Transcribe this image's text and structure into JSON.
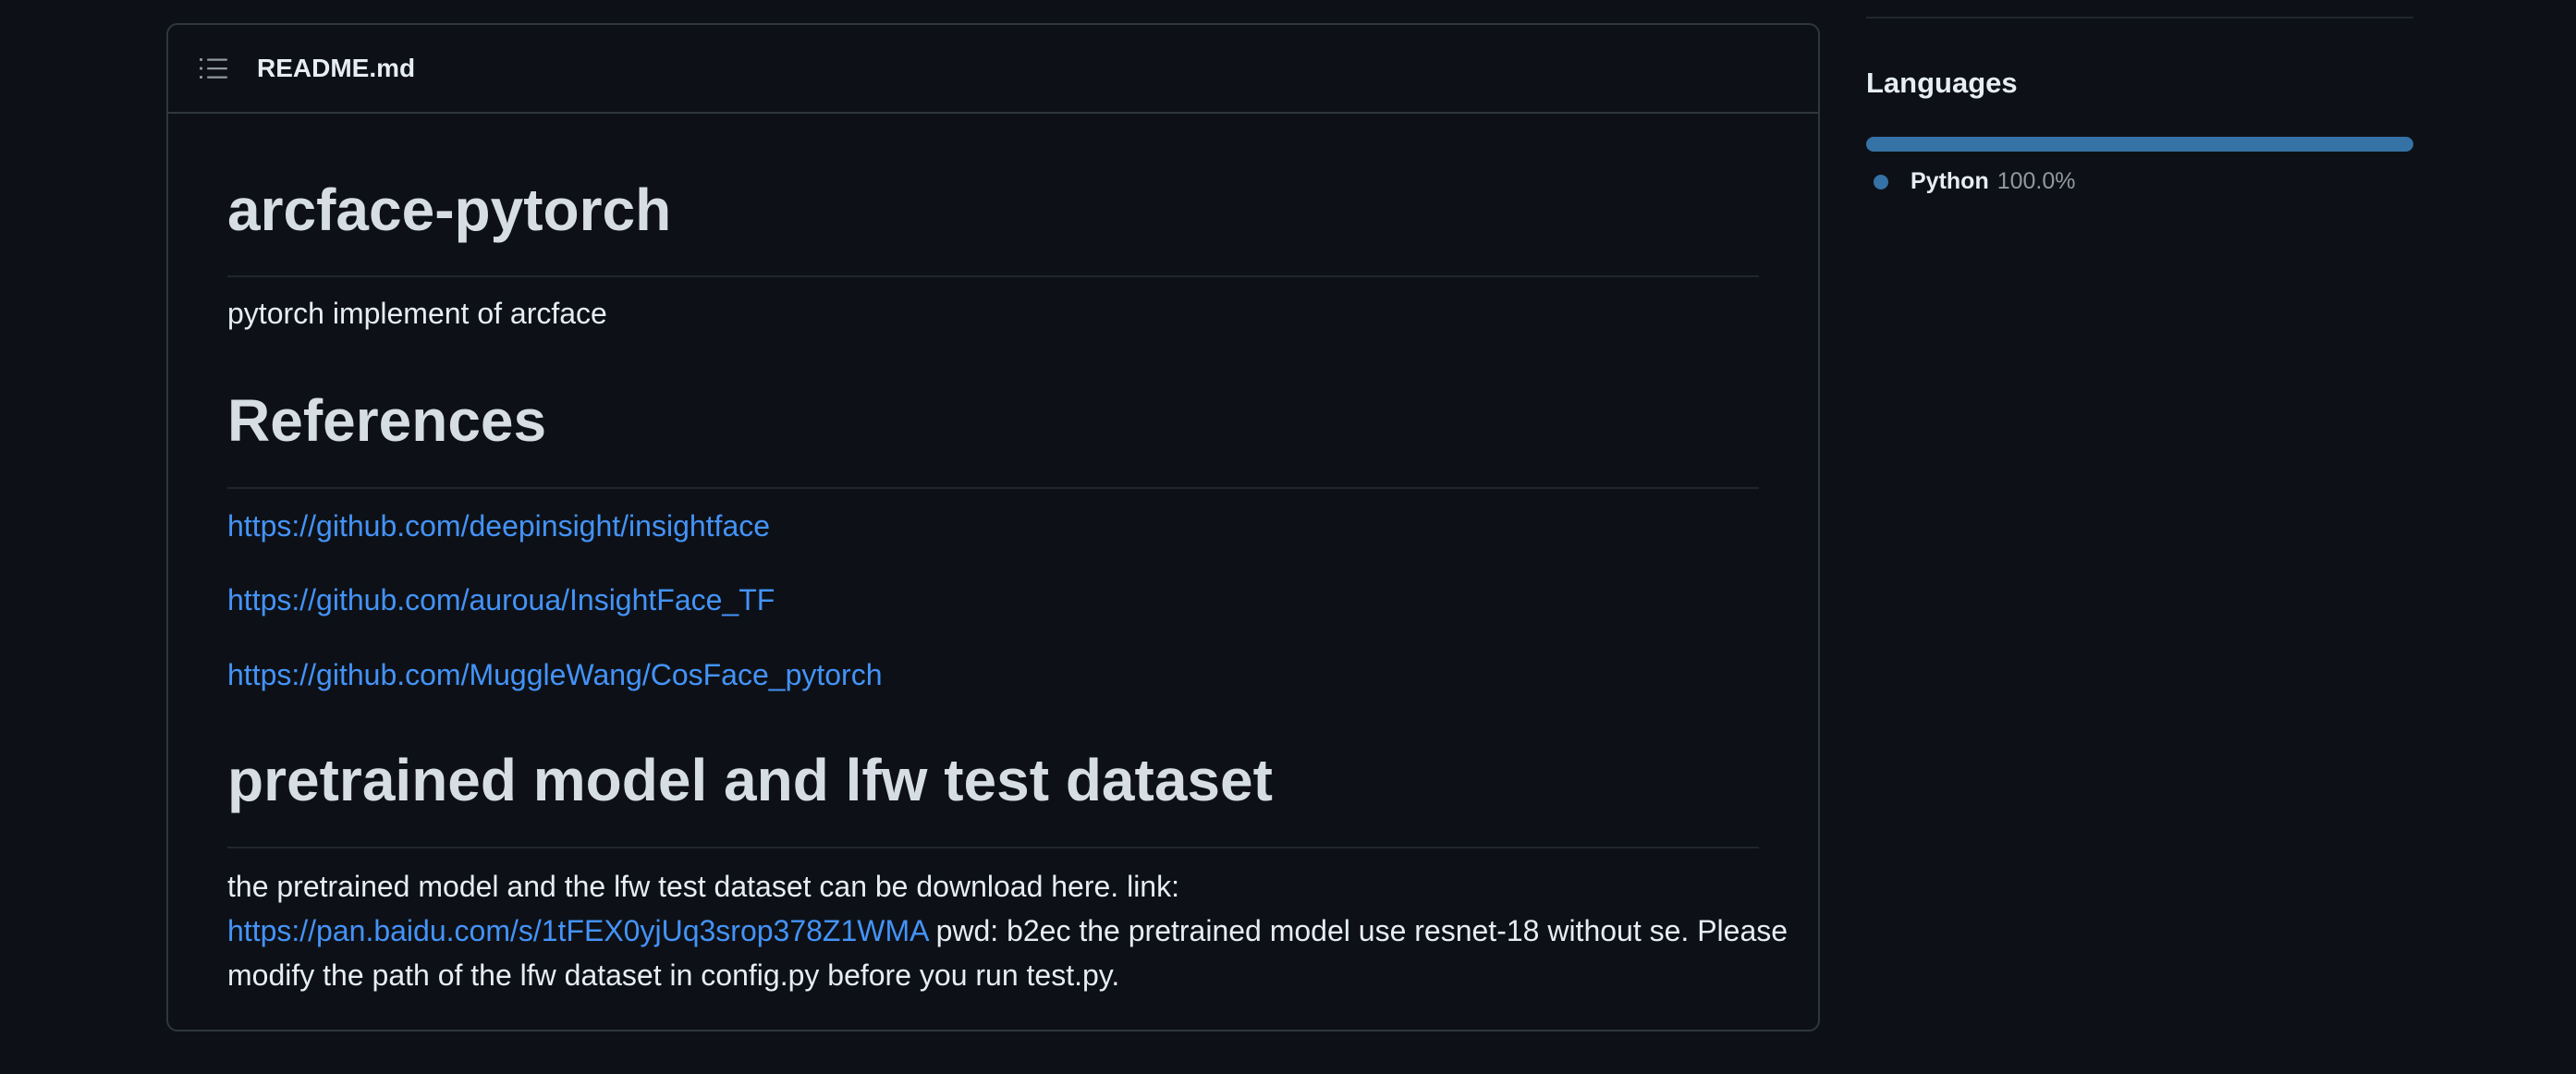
{
  "readme": {
    "filename": "README.md",
    "toc_icon": "list-unordered-icon",
    "sections": {
      "title": "arcface-pytorch",
      "description": "pytorch implement of arcface",
      "references_heading": "References",
      "references": [
        "https://github.com/deepinsight/insightface",
        "https://github.com/auroua/InsightFace_TF",
        "https://github.com/MuggleWang/CosFace_pytorch"
      ],
      "pretrained_heading": "pretrained model and lfw test dataset",
      "pretrained_text_1": "the pretrained model and the lfw test dataset can be download here. link:",
      "pretrained_link": "https://pan.baidu.com/s/1tFEX0yjUq3srop378Z1WMA",
      "pretrained_text_2": " pwd: b2ec the pretrained model use resnet-18 without se. Please modify the path of the lfw dataset in config.py before you run test.py."
    }
  },
  "sidebar": {
    "languages_title": "Languages",
    "languages": [
      {
        "name": "Python",
        "percent": "100.0%",
        "fraction": 1.0,
        "color": "#3572a5"
      }
    ]
  },
  "colors": {
    "background": "#0d1117",
    "border": "#30363d",
    "link": "#4493f8",
    "python": "#3572a5"
  }
}
